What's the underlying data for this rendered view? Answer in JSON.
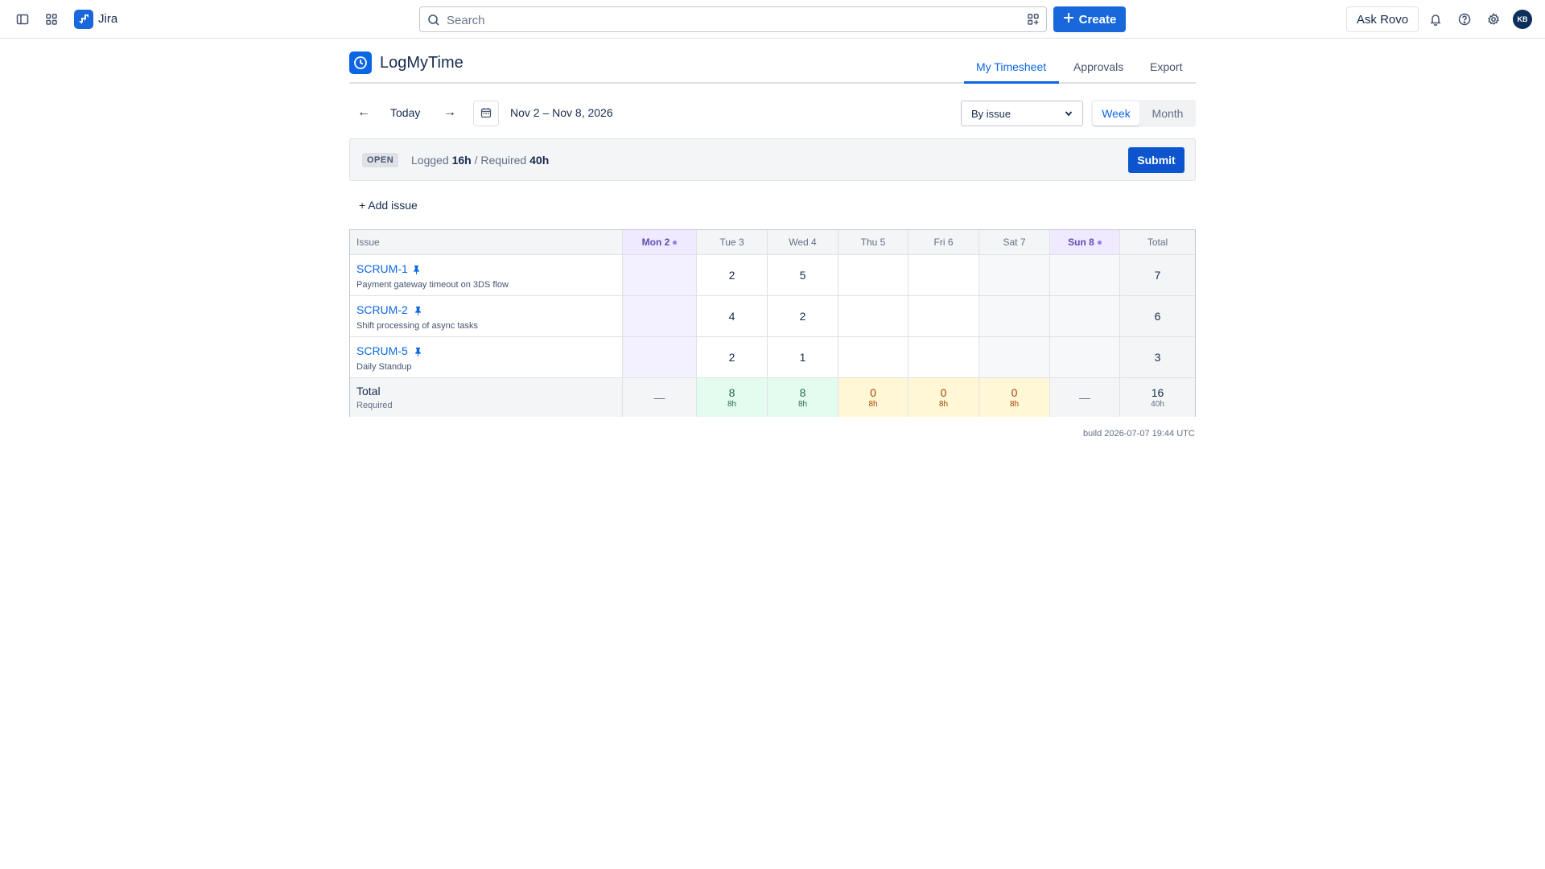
{
  "topbar": {
    "product_name": "Jira",
    "search_placeholder": "Search",
    "create_label": "Create",
    "ask_rovo_label": "Ask Rovo",
    "avatar_initials": "KB"
  },
  "app": {
    "title": "LogMyTime",
    "tabs": [
      {
        "label": "My Timesheet",
        "active": true
      },
      {
        "label": "Approvals",
        "active": false
      },
      {
        "label": "Export",
        "active": false
      }
    ]
  },
  "toolbar": {
    "prev_arrow": "←",
    "today_label": "Today",
    "next_arrow": "→",
    "date_range": "Nov 2 – Nov 8, 2026",
    "group_by_value": "By issue",
    "view_week": "Week",
    "view_month": "Month",
    "selected_view": "Week"
  },
  "status": {
    "badge": "OPEN",
    "logged_label": "Logged",
    "logged_value": "16h",
    "separator": "/",
    "required_label": "Required",
    "required_value": "40h",
    "submit_label": "Submit"
  },
  "add_issue_label": "+ Add issue",
  "table": {
    "issue_header": "Issue",
    "total_header": "Total",
    "days": [
      {
        "label": "Mon 2",
        "highlight": true
      },
      {
        "label": "Tue 3",
        "highlight": false
      },
      {
        "label": "Wed 4",
        "highlight": false
      },
      {
        "label": "Thu 5",
        "highlight": false
      },
      {
        "label": "Fri 6",
        "highlight": false
      },
      {
        "label": "Sat 7",
        "highlight": false
      },
      {
        "label": "Sun 8",
        "highlight": true
      }
    ],
    "rows": [
      {
        "key": "SCRUM-1",
        "summary": "Payment gateway timeout on 3DS flow",
        "values": [
          "",
          "2",
          "5",
          "",
          "",
          "",
          ""
        ],
        "total": "7"
      },
      {
        "key": "SCRUM-2",
        "summary": "Shift processing of async tasks",
        "values": [
          "",
          "4",
          "2",
          "",
          "",
          "",
          ""
        ],
        "total": "6"
      },
      {
        "key": "SCRUM-5",
        "summary": "Daily Standup",
        "values": [
          "",
          "2",
          "1",
          "",
          "",
          "",
          ""
        ],
        "total": "3"
      }
    ],
    "totals_row": {
      "label": "Total",
      "sublabel": "Required",
      "cells": [
        {
          "value": "—",
          "required": "",
          "state": "none"
        },
        {
          "value": "8",
          "required": "8h",
          "state": "ok"
        },
        {
          "value": "8",
          "required": "8h",
          "state": "ok"
        },
        {
          "value": "0",
          "required": "8h",
          "state": "warn"
        },
        {
          "value": "0",
          "required": "8h",
          "state": "warn"
        },
        {
          "value": "0",
          "required": "8h",
          "state": "warn"
        },
        {
          "value": "—",
          "required": "",
          "state": "none"
        }
      ],
      "grand_total": "16",
      "grand_required": "40h"
    }
  },
  "build_info": "build 2026-07-07 19:44 UTC",
  "colors": {
    "brand_blue": "#0c66e4",
    "highlight_purple": "#5e4db2",
    "ok_green": "#216e4e",
    "warn_orange": "#a54800"
  }
}
